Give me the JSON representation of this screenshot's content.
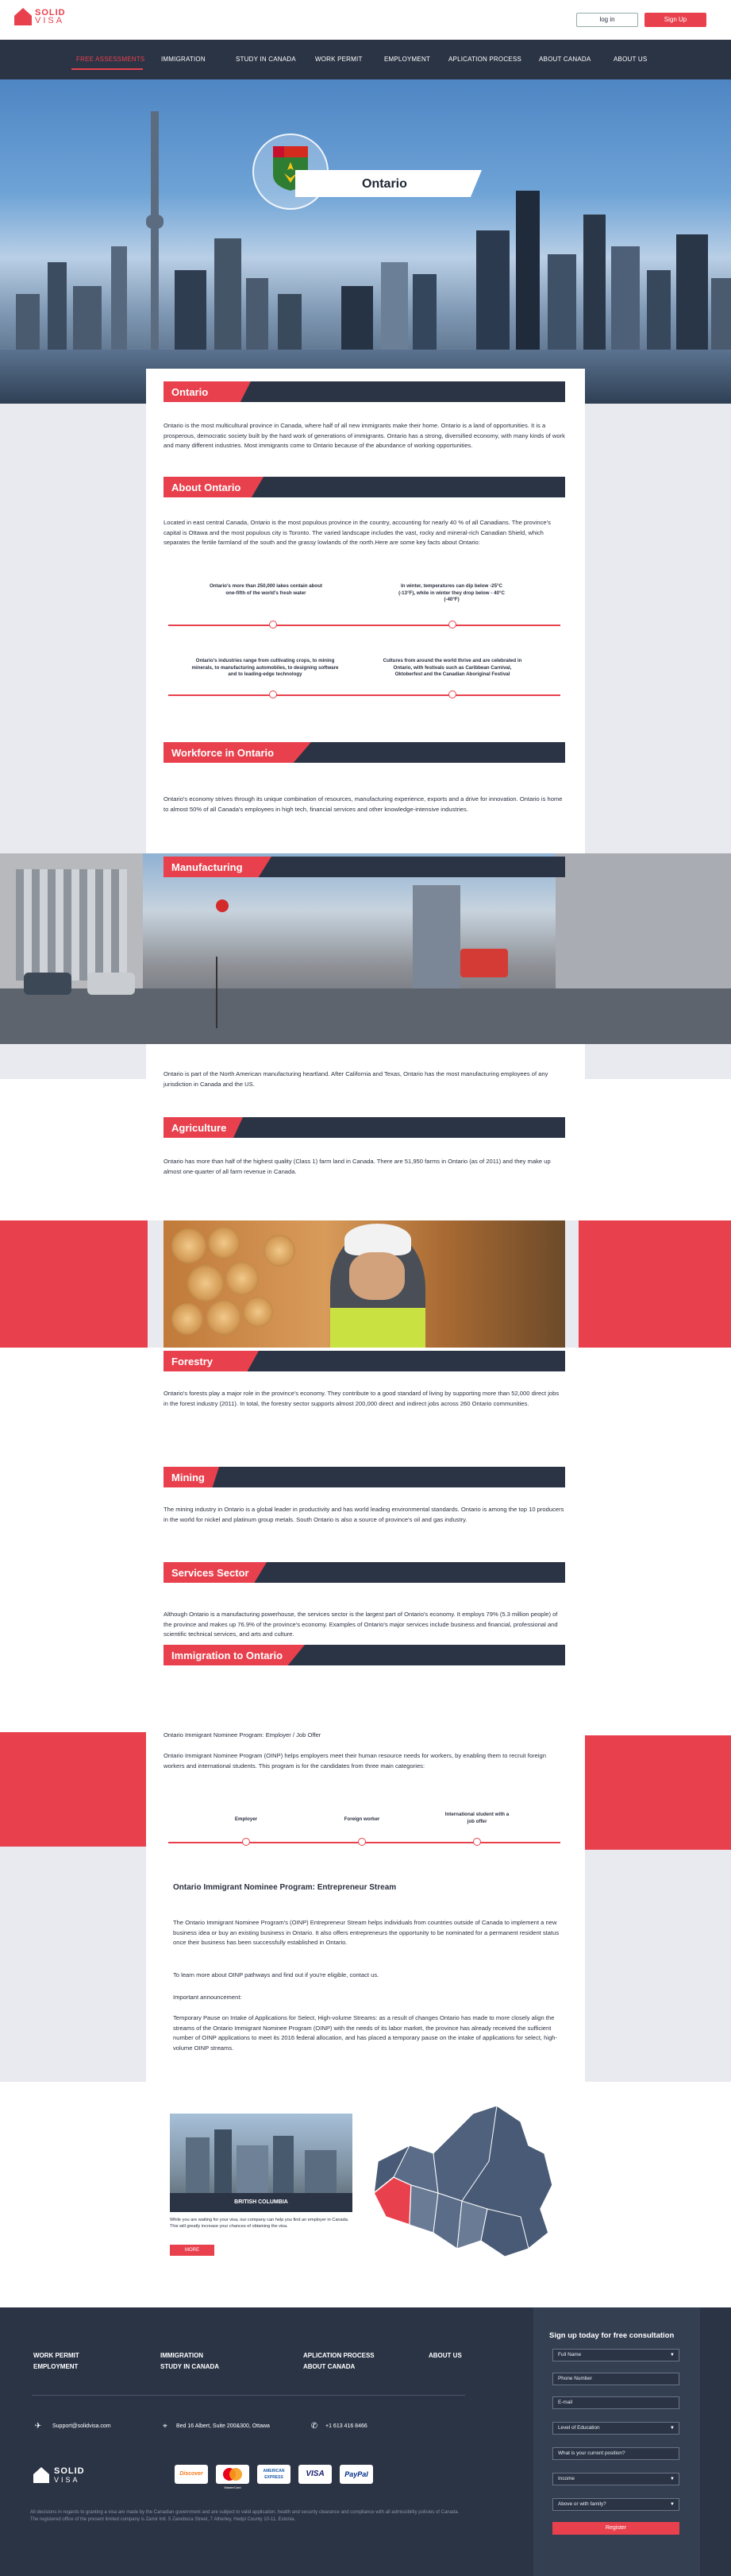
{
  "header": {
    "logo_top": "SOLID",
    "logo_bottom": "VISA",
    "login_label": "log in",
    "signup_label": "Sign Up"
  },
  "nav": {
    "items": [
      "FREE ASSESSMENTS",
      "IMMIGRATION",
      "STUDY IN CANADA",
      "WORK PERMIT",
      "EMPLOYMENT",
      "APLICATION PROCESS",
      "ABOUT CANADA",
      "ABOUT US"
    ]
  },
  "hero": {
    "title": "Ontario"
  },
  "sections": {
    "ontario": {
      "title": "Ontario",
      "text": "Ontario is the most multicultural province in Canada, where half of all new immigrants make their home. Ontario is a land of opportunities. It is a prosperous, democratic society built by the hard work of generations of immigrants. Ontario has a strong, diversified economy, with many kinds of work and many different industries. Most immigrants come to Ontario because of the abundance of working opportunities."
    },
    "about": {
      "title": "About Ontario",
      "text": "Located in east central Canada, Ontario is the most populous province in the country, accounting for nearly 40 % of all Canadians. The province's capital is Ottawa and the most populous city is Toronto. The varied landscape includes the vast, rocky and mineral-rich Canadian Shield, which separates the fertile farmland of the south and the grassy lowlands of the north.Here are some key facts about Ontario:",
      "facts": [
        "Ontario's more than 250,000 lakes contain about one-fifth of the world's fresh water",
        "In winter, temperatures can dip below -25°C (-13°F), while in winter they drop below - 40°C (-40°F)",
        "Ontario's industries range from cultivating crops, to mining minerals, to manufacturing automobiles, to designing software and to leading-edge technology",
        "Cultures from around the world thrive and are celebrated in Ontario, with festivals such as Caribbean Carnival, Oktoberfest and the Canadian Aboriginal Festival"
      ]
    },
    "workforce": {
      "title": "Workforce in Ontario",
      "text": "Ontario's economy strives through its unique combination of resources, manufacturing experience, exports and a drive for innovation. Ontario is home to almost 50% of all Canada's employees in high tech, financial services and other knowledge-intensive industries."
    },
    "manufacturing": {
      "title": "Manufacturing",
      "text": "Ontario is part of the North American manufacturing heartland. After California and Texas, Ontario has the most manufacturing employees of any jurisdiction in Canada and the US."
    },
    "agriculture": {
      "title": "Agriculture",
      "text": "Ontario has more than half of the highest quality (Class 1) farm land in Canada. There are 51,950 farms in Ontario (as of 2011) and they make up almost one-quarter of all farm revenue in Canada."
    },
    "forestry": {
      "title": "Forestry",
      "text": "Ontario's forests play a major role in the province's economy. They contribute to a good standard of living by supporting more than 52,000 direct jobs in the forest industry (2011). In total, the forestry sector supports almost 200,000 direct and indirect jobs across 260 Ontario communities."
    },
    "mining": {
      "title": "Mining",
      "text": "The mining industry in Ontario is a global leader in productivity and has world leading environmental standards. Ontario is among the top 10 producers in the world for nickel and platinum group metals. South Ontario is also a source of province's oil and gas industry."
    },
    "services": {
      "title": "Services Sector",
      "text": "Although Ontario is a manufacturing powerhouse, the services sector is the largest part of Ontario's economy. It employs 79% (5.3 million people) of the province and makes up 76.9% of the province's economy. Examples of Ontario's major services include business and financial, professional and scientific technical services, and arts and culture."
    },
    "immigration": {
      "title": "Immigration to Ontario",
      "subtitle": "Ontario Immigrant Nominee Program: Employer / Job Offer",
      "text": "Ontario Immigrant Nominee Program (OINP) helps employers meet their human resource needs for workers, by enabling them to recruit foreign workers and international students. This program is for the candidates from three main categories:",
      "categories": [
        "Employer",
        "Foreign worker",
        "International student with a job offer"
      ],
      "entrepreneur_title": "Ontario Immigrant Nominee Program: Entrepreneur Stream",
      "entrepreneur_text": "The Ontario Immigrant Nominee Program's (OINP) Entrepreneur Stream helps individuals from countries outside of Canada to implement a new business idea or buy an existing business in Ontario. It also offers entrepreneurs the opportunity to be nominated for a permanent resident status once their business has been successfully established in Ontario.",
      "learn_more": "To learn more about OINP pathways and find out if you're eligible, contact us.",
      "announcement_label": "Important announcement:",
      "announcement_text": "Temporary Pause on Intake of Applications for Select, High-volume Streams: as a result of changes Ontario has made to more closely align the streams of the Ontario Immigrant Nominee Program (OINP) with the needs of its labor market, the province has already received the sufficient number of OINP applications to meet its 2016 federal allocation, and has placed a temporary pause on the intake of applications for select, high-volume OINP streams."
    }
  },
  "bottom_card": {
    "label": "BRITISH COLUMBIA",
    "text": "While you are waiting for your visa, our company can help you find an employer in Canada. This will greatly increase your chances of obtaining the visa.",
    "button": "MORE"
  },
  "footer": {
    "links_col1": [
      "WORK PERMIT",
      "EMPLOYMENT"
    ],
    "links_col2": [
      "IMMIGRATION",
      "STUDY IN CANADA"
    ],
    "links_col3": [
      "APLICATION PROCESS",
      "ABOUT CANADA"
    ],
    "links_col4": [
      "ABOUT US"
    ],
    "email": "Support@solidvisa.com",
    "address": "Bed 16 Albert, Suite 200&300, Ottawa",
    "phone": "+1 613 416 8466",
    "logo_top": "SOLID",
    "logo_bottom": "VISA",
    "payments": [
      "Discover",
      "MasterCard",
      "AMERICAN EXPRESS",
      "VISA",
      "PayPal"
    ],
    "disclaimer": "All decisions in regards to granting a visa are made by the Canadian government and are subject to valid application, health and security clearance and compliance with all admissibility policies of Canada. The registered office of the present limited company is Zamir Intl. 5 Zaneboca Street, 7 Atherley, Hedpi County 10-11, Estonia."
  },
  "form": {
    "title": "Sign up today for free consultation",
    "fields": [
      "Full Name",
      "Phone Number",
      "E-mail",
      "Level of Education",
      "What is your current position?",
      "Income",
      "Above or with family?"
    ],
    "submit": "Register"
  },
  "colors": {
    "accent": "#e8414d",
    "navy": "#2b3445"
  }
}
